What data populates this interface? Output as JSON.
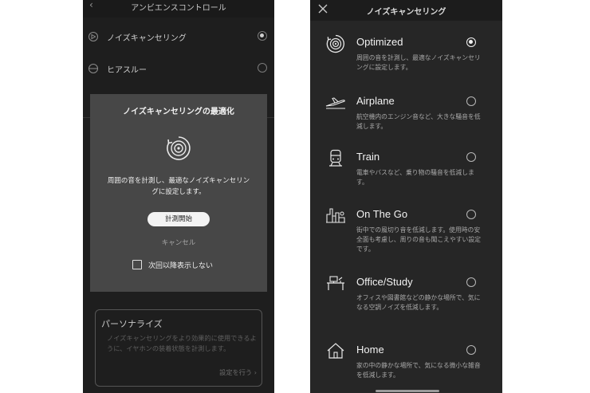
{
  "left_screen": {
    "header": {
      "title": "アンビエンスコントロール",
      "back_glyph": "‹"
    },
    "options": [
      {
        "icon": "noise-cancel-icon",
        "label": "ノイズキャンセリング",
        "selected": true
      },
      {
        "icon": "ear-icon",
        "label": "ヒアスルー",
        "selected": false
      }
    ],
    "dialog": {
      "title": "ノイズキャンセリングの最適化",
      "icon": "optimize-icon",
      "text": "周囲の音を計測し、最適なノイズキャンセリングに設定します。",
      "start_label": "計測開始",
      "cancel_label": "キャンセル",
      "checkbox_label": "次回以降表示しない",
      "checkbox_checked": false
    },
    "personalize": {
      "title": "パーソナライズ",
      "text": "ノイズキャンセリングをより効果的に使用できるように、イヤホンの装着状態を計測します。",
      "link_label": "設定を行う ›"
    }
  },
  "right_screen": {
    "header": {
      "title": "ノイズキャンセリング",
      "close_icon": "close-icon"
    },
    "items": [
      {
        "icon": "optimized-icon",
        "name": "Optimized",
        "desc": "周囲の音を計測し、最適なノイズキャンセリングに設定します。",
        "selected": true
      },
      {
        "icon": "airplane-icon",
        "name": "Airplane",
        "desc": "航空機内のエンジン音など、大きな騒音を低減します。",
        "selected": false
      },
      {
        "icon": "train-icon",
        "name": "Train",
        "desc": "電車やバスなど、乗り物の騒音を低減します。",
        "selected": false
      },
      {
        "icon": "city-icon",
        "name": "On The Go",
        "desc": "街中での風切り音を低減します。使用時の安全面も考慮し、周りの音も聞こえやすい設定です。",
        "selected": false
      },
      {
        "icon": "desk-icon",
        "name": "Office/Study",
        "desc": "オフィスや図書館などの静かな場所で、気になる空調ノイズを低減します。",
        "selected": false
      },
      {
        "icon": "home-icon",
        "name": "Home",
        "desc": "家の中の静かな場所で、気になる微小な雑音を低減します。",
        "selected": false
      }
    ]
  },
  "colors": {
    "dark_bg": "#1e1e1e",
    "dialog_bg": "#474747",
    "text": "#f2f2f2",
    "muted": "#a9a9a9"
  }
}
